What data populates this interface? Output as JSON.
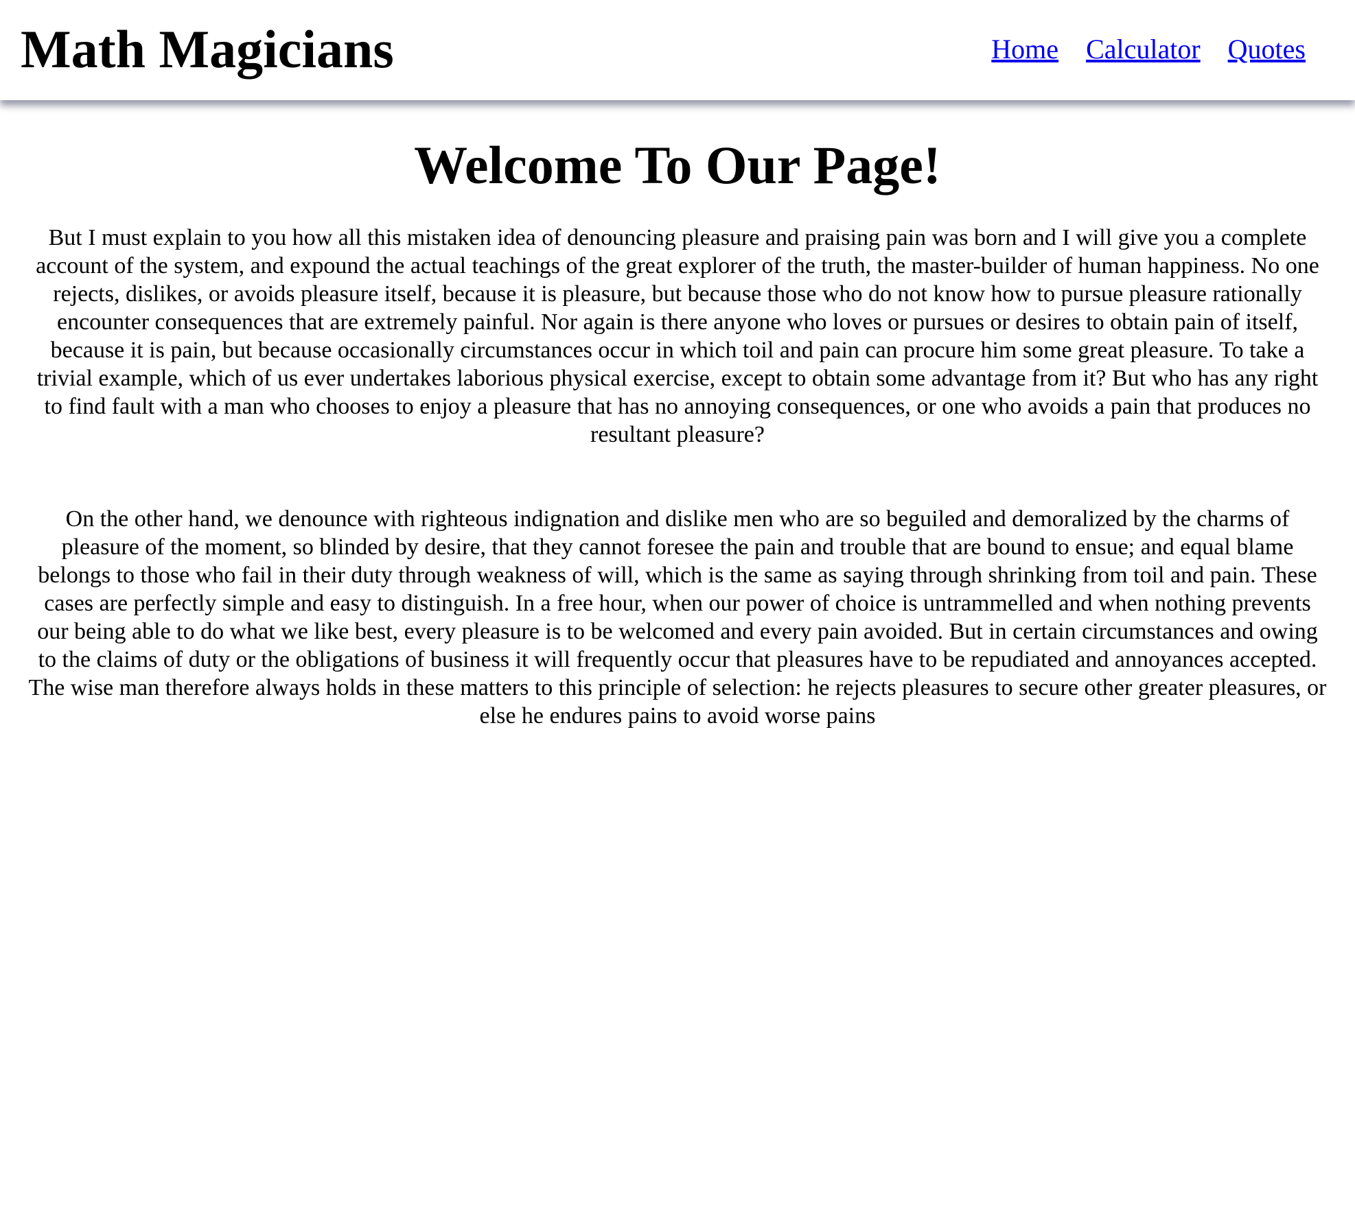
{
  "header": {
    "brand": "Math Magicians",
    "nav": [
      {
        "label": "Home"
      },
      {
        "label": "Calculator"
      },
      {
        "label": "Quotes"
      }
    ]
  },
  "main": {
    "title": "Welcome To Our Page!",
    "paragraphs": [
      "But I must explain to you how all this mistaken idea of denouncing pleasure and praising pain was born and I will give you a complete account of the system, and expound the actual teachings of the great explorer of the truth, the master-builder of human happiness. No one rejects, dislikes, or avoids pleasure itself, because it is pleasure, but because those who do not know how to pursue pleasure rationally encounter consequences that are extremely painful. Nor again is there anyone who loves or pursues or desires to obtain pain of itself, because it is pain, but because occasionally circumstances occur in which toil and pain can procure him some great pleasure. To take a trivial example, which of us ever undertakes laborious physical exercise, except to obtain some advantage from it? But who has any right to find fault with a man who chooses to enjoy a pleasure that has no annoying consequences, or one who avoids a pain that produces no resultant pleasure?",
      "On the other hand, we denounce with righteous indignation and dislike men who are so beguiled and demoralized by the charms of pleasure of the moment, so blinded by desire, that they cannot foresee the pain and trouble that are bound to ensue; and equal blame belongs to those who fail in their duty through weakness of will, which is the same as saying through shrinking from toil and pain. These cases are perfectly simple and easy to distinguish. In a free hour, when our power of choice is untrammelled and when nothing prevents our being able to do what we like best, every pleasure is to be welcomed and every pain avoided. But in certain circumstances and owing to the claims of duty or the obligations of business it will frequently occur that pleasures have to be repudiated and annoyances accepted. The wise man therefore always holds in these matters to this principle of selection: he rejects pleasures to secure other greater pleasures, or else he endures pains to avoid worse pains"
    ]
  },
  "colors": {
    "link": "#0000ee",
    "text": "#000000",
    "background": "#ffffff",
    "header_shadow": "#464664"
  }
}
